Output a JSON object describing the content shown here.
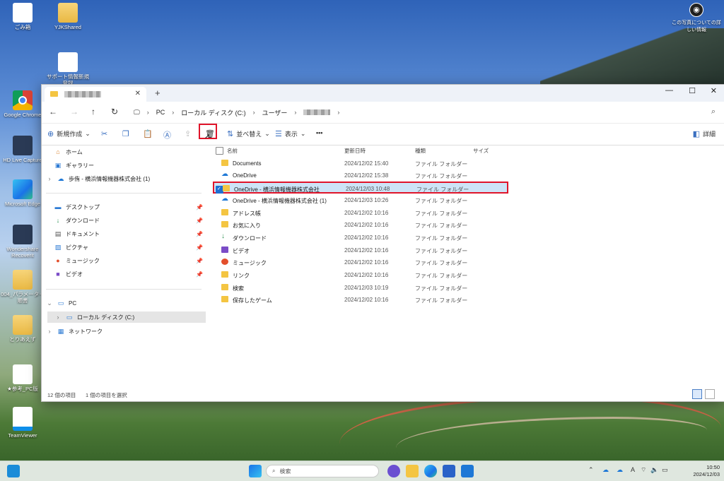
{
  "desktop": {
    "icons": [
      {
        "label": "ごみ箱"
      },
      {
        "label": "YJKShared"
      },
      {
        "label": "サポート情報新規登録"
      },
      {
        "label": "Google Chrome"
      },
      {
        "label": "HD Live Capture"
      },
      {
        "label": "Microsoft Edge"
      },
      {
        "label": "Wondershare Recoverit"
      },
      {
        "label": "004_パラメーター順書"
      },
      {
        "label": "とりあえず"
      },
      {
        "label": "★参考_PC版"
      },
      {
        "label": "TeamViewer"
      }
    ],
    "photo_info": "この写真についての詳しい情報"
  },
  "window": {
    "tab_close": "✕",
    "new_tab": "+",
    "controls": {
      "minimize": "—",
      "maximize": "☐",
      "close": "✕"
    }
  },
  "address": {
    "crumbs": [
      "PC",
      "ローカル ディスク (C:)",
      "ユーザー"
    ]
  },
  "toolbar": {
    "new_label": "新規作成",
    "sort_label": "並べ替え",
    "view_label": "表示",
    "more_label": "•••",
    "details_label": "詳細"
  },
  "sidebar": {
    "home": "ホーム",
    "gallery": "ギャラリー",
    "onedrive": "歩侑 - 横浜情報機器株式会社 (1)",
    "desktop": "デスクトップ",
    "downloads": "ダウンロード",
    "documents": "ドキュメント",
    "pictures": "ピクチャ",
    "music": "ミュージック",
    "videos": "ビデオ",
    "pc": "PC",
    "local_disk": "ローカル ディスク (C:)",
    "network": "ネットワーク"
  },
  "columns": {
    "name": "名前",
    "date": "更新日時",
    "type": "種類",
    "size": "サイズ"
  },
  "files": [
    {
      "name": "Documents",
      "date": "2024/12/02 15:40",
      "type": "ファイル フォルダー"
    },
    {
      "name": "OneDrive",
      "date": "2024/12/02 15:38",
      "type": "ファイル フォルダー"
    },
    {
      "name": "OneDrive - 横浜情報機器株式会社",
      "date": "2024/12/03 10:48",
      "type": "ファイル フォルダー"
    },
    {
      "name": "OneDrive - 横浜情報機器株式会社 (1)",
      "date": "2024/12/03 10:26",
      "type": "ファイル フォルダー"
    },
    {
      "name": "アドレス帳",
      "date": "2024/12/02 10:16",
      "type": "ファイル フォルダー"
    },
    {
      "name": "お気に入り",
      "date": "2024/12/02 10:16",
      "type": "ファイル フォルダー"
    },
    {
      "name": "ダウンロード",
      "date": "2024/12/02 10:16",
      "type": "ファイル フォルダー"
    },
    {
      "name": "ビデオ",
      "date": "2024/12/02 10:16",
      "type": "ファイル フォルダー"
    },
    {
      "name": "ミュージック",
      "date": "2024/12/02 10:16",
      "type": "ファイル フォルダー"
    },
    {
      "name": "リンク",
      "date": "2024/12/02 10:16",
      "type": "ファイル フォルダー"
    },
    {
      "name": "検索",
      "date": "2024/12/03 10:19",
      "type": "ファイル フォルダー"
    },
    {
      "name": "保存したゲーム",
      "date": "2024/12/02 10:16",
      "type": "ファイル フォルダー"
    }
  ],
  "status": {
    "count": "12 個の項目",
    "selected": "1 個の項目を選択"
  },
  "taskbar": {
    "search_placeholder": "検索",
    "time": "10:50",
    "date": "2024/12/03"
  }
}
